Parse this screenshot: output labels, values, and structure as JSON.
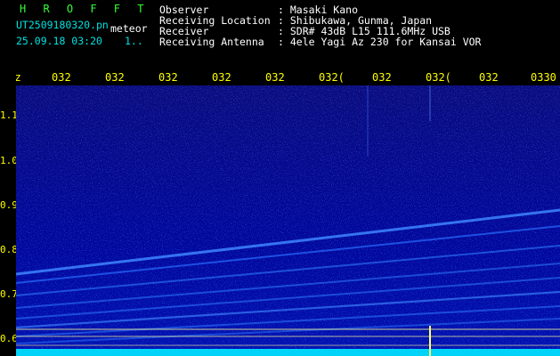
{
  "header": {
    "app_title": "H R O F F T",
    "filename": "UT2509180320.pn",
    "mode": "meteor",
    "datetime": "25.09.18 03:20",
    "page": "1..",
    "fields": [
      {
        "label": "Observer",
        "value": ": Masaki Kano"
      },
      {
        "label": "Receiving Location",
        "value": ": Shibukawa, Gunma, Japan"
      },
      {
        "label": "Receiver",
        "value": ": SDR# 43dB L15 111.6MHz USB"
      },
      {
        "label": "Receiving Antenna",
        "value": ": 4ele Yagi Az 230 for Kansai VOR"
      }
    ]
  },
  "y_axis": {
    "unit": "kHz",
    "ticks": [
      "1.1",
      "1.0",
      "0.9",
      "0.8",
      "0.7",
      "0.6"
    ]
  },
  "x_axis": {
    "ticks": [
      "032",
      "032",
      "032",
      "032",
      "032",
      "032(",
      "032",
      "032(",
      "032",
      "0330"
    ]
  },
  "colors": {
    "background": "#00008c",
    "trace": "#2f7cff",
    "baseline": "#00ffff",
    "axis": "#ffff00"
  }
}
